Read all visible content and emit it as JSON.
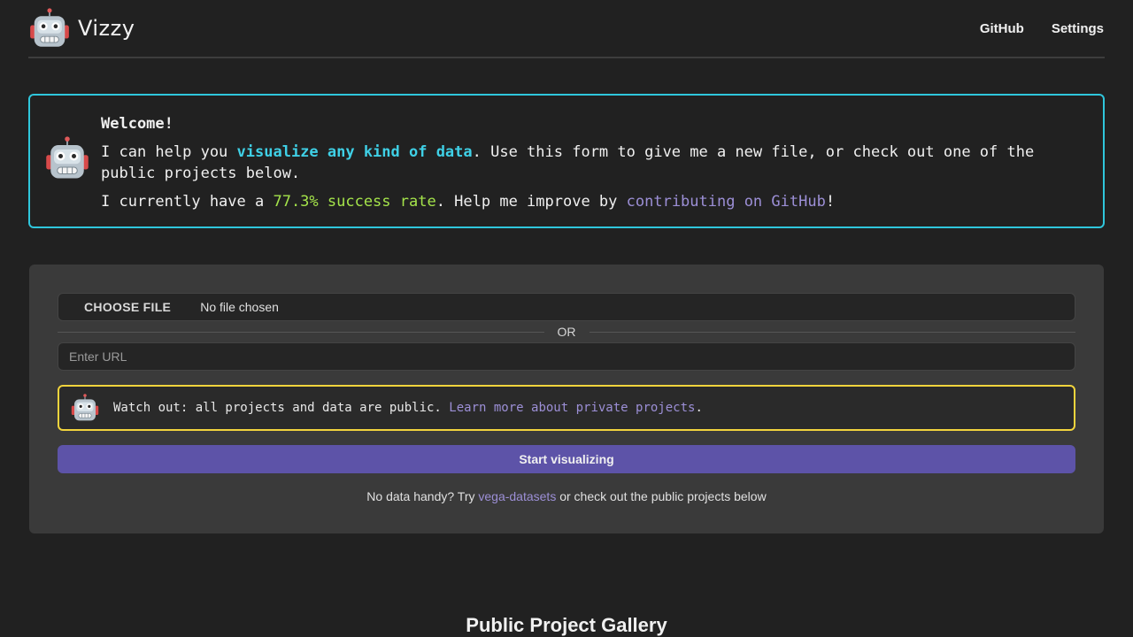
{
  "header": {
    "brand": "Vizzy",
    "logo_icon": "robot-icon",
    "nav": [
      "GitHub",
      "Settings"
    ]
  },
  "welcome": {
    "title": "Welcome!",
    "line1_prefix": "I can help you ",
    "line1_highlight": "visualize any kind of data",
    "line1_suffix": ". Use this form to give me a new file, or check out one of the public projects below.",
    "line2_prefix": "I currently have a ",
    "line2_rate": "77.3% success rate",
    "line2_middle": ". Help me improve by ",
    "line2_link": "contributing on GitHub",
    "line2_suffix": "!"
  },
  "form": {
    "choose_file_label": "CHOOSE FILE",
    "file_status": "No file chosen",
    "or_label": "OR",
    "url_placeholder": "Enter URL",
    "url_value": "",
    "warning_prefix": "Watch out: all projects and data are public. ",
    "warning_link": "Learn more about private projects",
    "warning_suffix": ".",
    "start_button": "Start visualizing",
    "hint_prefix": "No data handy? Try ",
    "hint_link": "vega-datasets",
    "hint_suffix": " or check out the public projects below"
  },
  "gallery": {
    "title": "Public Project Gallery"
  },
  "colors": {
    "accent_cyan": "#2fc6dc",
    "accent_yellow": "#f2d43d",
    "button_purple": "#5d53a8",
    "success_green": "#a4e34a",
    "link_purple": "#9c8fd6"
  }
}
